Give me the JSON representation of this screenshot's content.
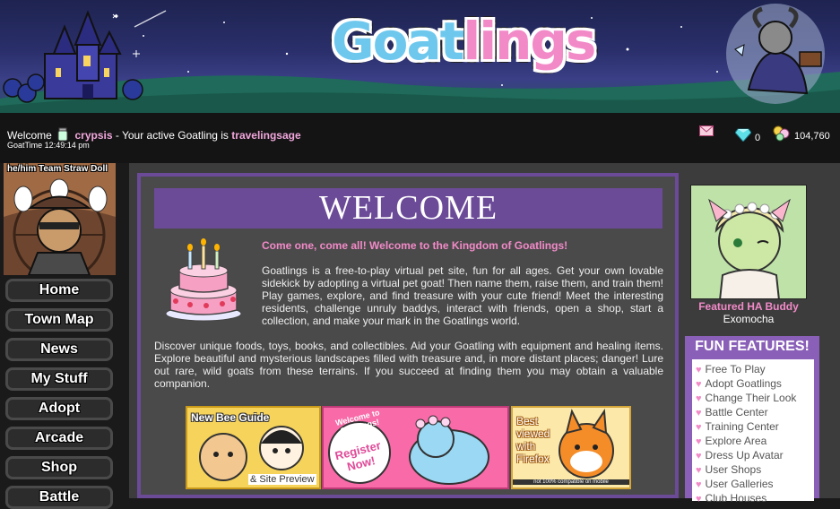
{
  "header": {
    "logo_part1": "Goat",
    "logo_part2": "lings"
  },
  "userbar": {
    "welcome": "Welcome",
    "username": "crypsis",
    "active_text": "- Your active Goatling is",
    "active_pet": "travelingsage",
    "goattime": "GoatTime 12:49:14 pm",
    "gems": "0",
    "gold": "104,760"
  },
  "sidebar": {
    "pet_caption": "he/him Team Straw Doll",
    "nav": [
      "Home",
      "Town Map",
      "News",
      "My Stuff",
      "Adopt",
      "Arcade",
      "Shop",
      "Battle"
    ]
  },
  "main": {
    "heading": "WELCOME",
    "intro": "Come one, come all! Welcome to the Kingdom of Goatlings!",
    "paragraph1": "Goatlings is a free-to-play virtual pet site, fun for all ages. Get your own lovable sidekick by adopting a virtual pet goat! Then name them, raise them, and train them! Play games, explore, and find treasure with your cute friend! Meet the interesting residents, challenge unruly baddys, interact with friends, open a shop, start a collection, and make your mark in the Goatlings world.",
    "paragraph2": "Discover unique foods, toys, books, and collectibles. Aid your Goatling with equipment and healing items. Explore beautiful and mysterious landscapes filled with treasure and, in more distant places; danger! Lure out rare, wild goats from these terrains. If you succeed at finding them you may obtain a valuable companion.",
    "promos": {
      "bee_title": "New Bee Guide",
      "bee_sub": "& Site Preview",
      "register_top": "Welcome to Goatlings!",
      "register_main": "Register Now!",
      "firefox": "Best viewed with Firefox",
      "firefox_sub": "not 100% compatible on mobile"
    }
  },
  "right": {
    "buddy_label": "Featured HA Buddy",
    "buddy_name": "Exomocha",
    "fun_heading": "FUN FEATURES!",
    "fun_items": [
      "Free To Play",
      "Adopt Goatlings",
      "Change Their Look",
      "Battle Center",
      "Training Center",
      "Explore Area",
      "Dress Up Avatar",
      "User Shops",
      "User Galleries",
      "Club Houses"
    ]
  }
}
